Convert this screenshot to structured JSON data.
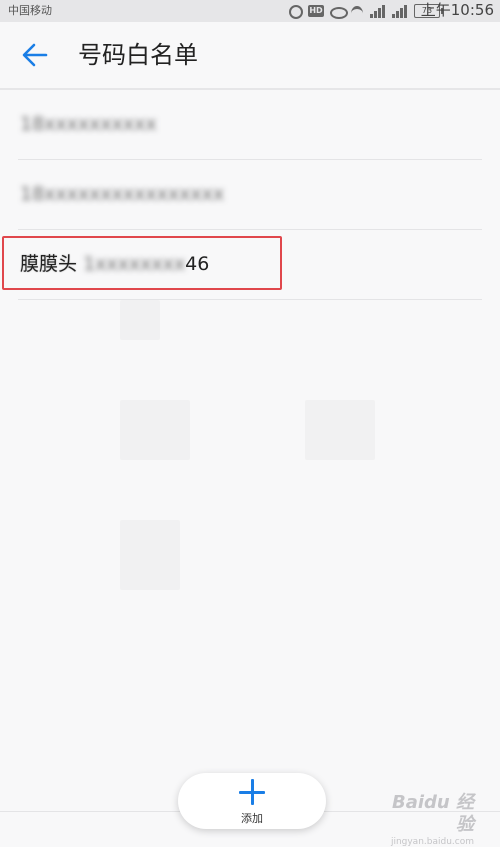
{
  "status_bar": {
    "carrier": "中国移动",
    "hd_badge": "HD",
    "battery": "73",
    "time": "上午10:56"
  },
  "app_bar": {
    "title": "号码白名单"
  },
  "whitelist": {
    "items": [
      {
        "masked_text": "18xxxxxxxxxx"
      },
      {
        "masked_text": "18xxxxxxxxxxxxxxxx"
      },
      {
        "name": "膜膜头",
        "masked_text": "1xxxxxxxx",
        "visible_suffix": "46"
      }
    ]
  },
  "add_button": {
    "label": "添加"
  },
  "watermark": {
    "logo": "Baidu 经验",
    "sub": "jingyan.baidu.com"
  },
  "colors": {
    "accent": "#1a7ee6",
    "highlight": "#e0474c"
  }
}
